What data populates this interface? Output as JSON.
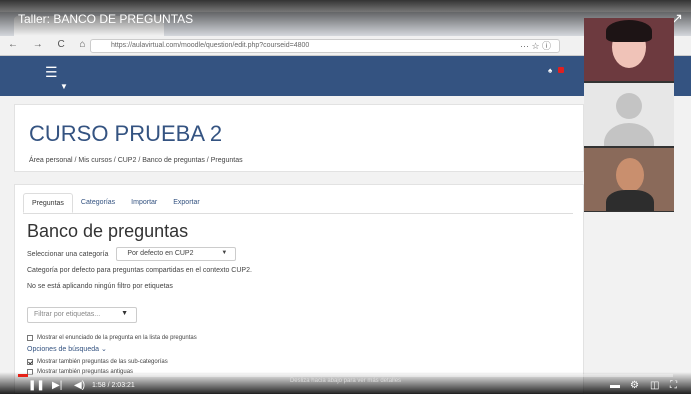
{
  "video": {
    "title": "Taller: BANCO DE PREGUNTAS",
    "share_icon": "share-icon",
    "progress": 0.015,
    "time": "1:58 / 2:03:21",
    "scroll_hint": "Desliza hacia abajo para ver más detalles"
  },
  "browser": {
    "url": "https://aulavirtual.com/moodle/question/edit.php?courseid=4800",
    "nav": "← → C ⌂"
  },
  "course": {
    "title": "CURSO PRUEBA 2",
    "breadcrumb": "Área personal / Mis cursos / CUP2 / Banco de preguntas / Preguntas"
  },
  "tabs": [
    {
      "label": "Preguntas"
    },
    {
      "label": "Categorías"
    },
    {
      "label": "Importar"
    },
    {
      "label": "Exportar"
    }
  ],
  "bank": {
    "title": "Banco de preguntas",
    "select_label": "Seleccionar una categoría",
    "select_value": "Por defecto en CUP2",
    "default_text": "Categoría por defecto para preguntas compartidas en el contexto CUP2.",
    "no_filter_text": "No se está aplicando ningún filtro por etiquetas",
    "filter_placeholder": "Filtrar por etiquetas...",
    "show_text_label": "Mostrar el enunciado de la pregunta en la lista de preguntas",
    "search_options": "Opciones de búsqueda ⌄",
    "subcat_label": "Mostrar también preguntas de las sub-categorías",
    "old_label": "Mostrar también preguntas antiguas"
  },
  "colors": {
    "brand": "#345381",
    "progress": "#e62117"
  }
}
